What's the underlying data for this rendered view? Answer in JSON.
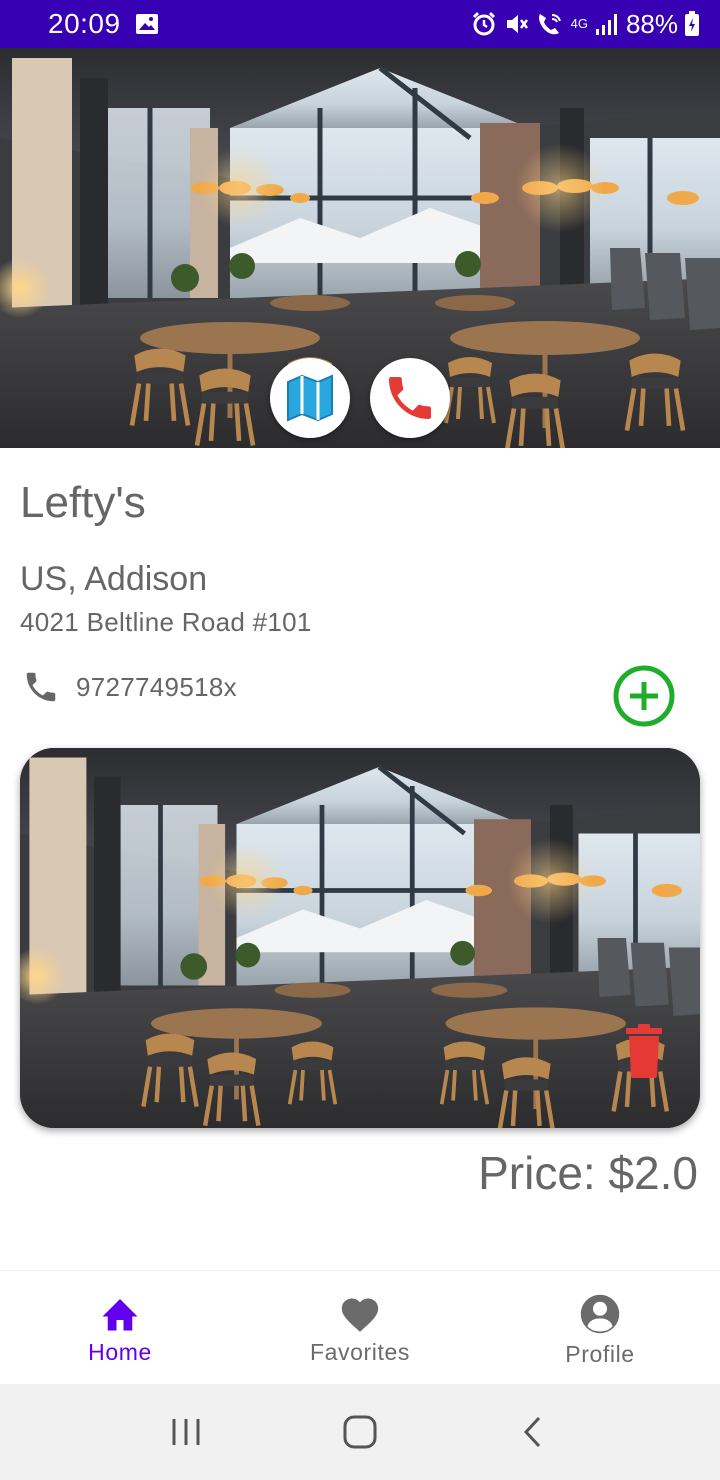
{
  "status_bar": {
    "time": "20:09",
    "network": "4G",
    "battery": "88%",
    "bg_color": "#3700b3"
  },
  "hero": {
    "buttons": [
      {
        "name": "map",
        "icon": "map-icon",
        "color": "#29a8e0"
      },
      {
        "name": "call",
        "icon": "phone-icon",
        "color": "#e53935"
      }
    ]
  },
  "restaurant": {
    "name": "Lefty's",
    "region": "US, Addison",
    "address": "4021 Beltline Road #101",
    "phone": "9727749518x"
  },
  "add_button": {
    "icon": "add-circle-icon",
    "color": "#1fae2b"
  },
  "card": {
    "delete_icon": "trash-icon",
    "delete_color": "#e53935",
    "price": "Price: $2.0"
  },
  "bottom_nav": {
    "items": [
      {
        "label": "Home",
        "icon": "home-icon",
        "active": true
      },
      {
        "label": "Favorites",
        "icon": "heart-icon",
        "active": false
      },
      {
        "label": "Profile",
        "icon": "account-circle-icon",
        "active": false
      }
    ],
    "active_color": "#6200ee"
  },
  "system_nav": {
    "buttons": [
      "recent-apps-icon",
      "home-circle-icon",
      "back-icon"
    ]
  }
}
